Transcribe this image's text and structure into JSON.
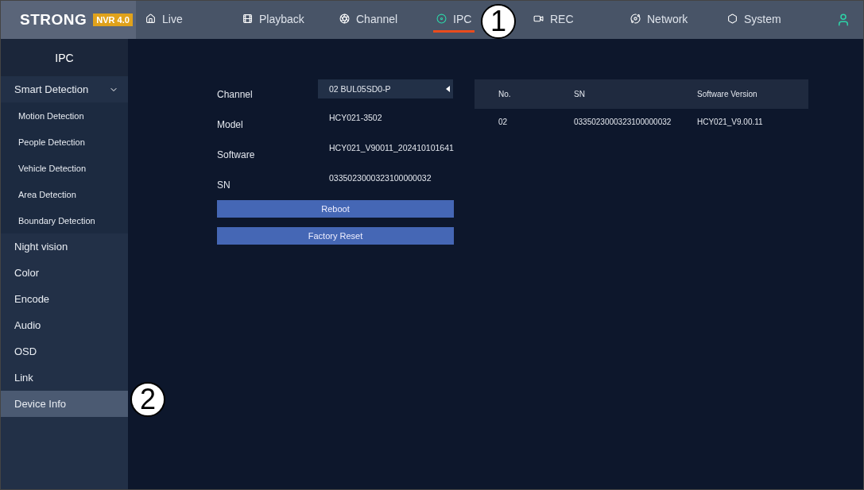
{
  "header": {
    "logo": "STRONG",
    "badge": "NVR 4.0"
  },
  "nav": [
    {
      "label": "Live",
      "selected": false
    },
    {
      "label": "Playback",
      "selected": false
    },
    {
      "label": "Channel",
      "selected": false
    },
    {
      "label": "IPC",
      "selected": true
    },
    {
      "label": "REC",
      "selected": false
    },
    {
      "label": "Network",
      "selected": false
    },
    {
      "label": "System",
      "selected": false
    }
  ],
  "sidebar": {
    "title": "IPC",
    "items": [
      {
        "label": "Smart Detection",
        "selected": false,
        "expanded": true,
        "children": [
          {
            "label": "Motion Detection",
            "selected": false
          },
          {
            "label": "People Detection",
            "selected": false
          },
          {
            "label": "Vehicle Detection",
            "selected": false
          },
          {
            "label": "Area Detection",
            "selected": false
          },
          {
            "label": "Boundary Detection",
            "selected": false
          }
        ]
      },
      {
        "label": "Night vision",
        "selected": false
      },
      {
        "label": "Color",
        "selected": false
      },
      {
        "label": "Encode",
        "selected": false
      },
      {
        "label": "Audio",
        "selected": false
      },
      {
        "label": "OSD",
        "selected": false
      },
      {
        "label": "Link",
        "selected": false
      },
      {
        "label": "Device Info",
        "selected": true
      }
    ]
  },
  "form": {
    "fields": [
      {
        "label": "Channel",
        "value": "02 BUL05SD0-P",
        "kind": "select"
      },
      {
        "label": "Model",
        "value": "HCY021-3502",
        "kind": "text"
      },
      {
        "label": "Software",
        "value": "HCY021_V90011_202410101641",
        "kind": "text"
      },
      {
        "label": "SN",
        "value": "0335023000323100000032",
        "kind": "text"
      }
    ],
    "buttons": [
      "Reboot",
      "Factory Reset"
    ]
  },
  "table": {
    "columns": [
      "No.",
      "SN",
      "Software Version"
    ],
    "rows": [
      [
        "02",
        "0335023000323100000032",
        "HCY021_V9.00.11"
      ]
    ]
  },
  "callouts": [
    {
      "label": "1"
    },
    {
      "label": "2"
    }
  ]
}
